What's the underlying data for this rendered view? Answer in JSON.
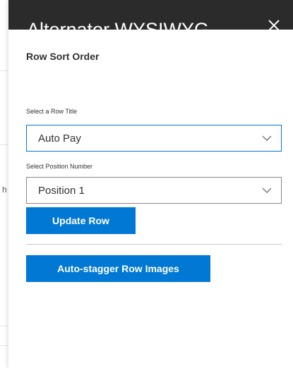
{
  "underlying_page": {
    "fragment_text": "h"
  },
  "panel": {
    "title": "Alternator WYSIWYG",
    "close_icon": "close-icon"
  },
  "row_sort": {
    "section_title": "Row Sort Order",
    "row_title_label": "Select a Row Title",
    "row_title_value": "Auto Pay",
    "position_label": "Select Position Number",
    "position_value": "Position 1",
    "update_button": "Update Row",
    "auto_stagger_button": "Auto-stagger Row Images"
  },
  "colors": {
    "accent": "#0078d4",
    "header_bg": "#2b2b2b"
  }
}
